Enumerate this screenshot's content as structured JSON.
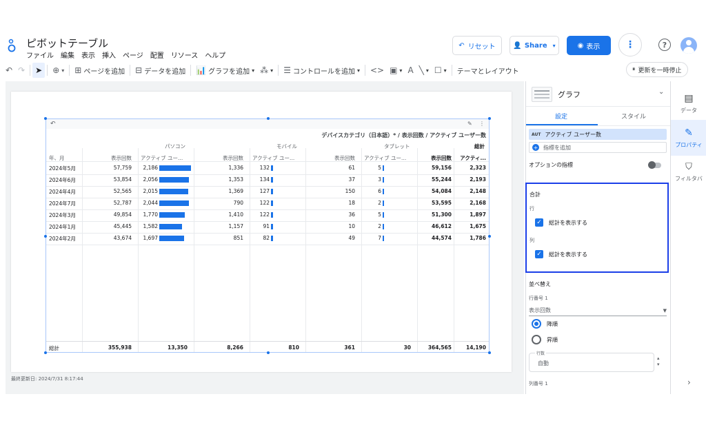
{
  "header": {
    "title": "ピボットテーブル",
    "menu": [
      "ファイル",
      "編集",
      "表示",
      "挿入",
      "ページ",
      "配置",
      "リソース",
      "ヘルプ"
    ],
    "reset_label": "リセット",
    "share_label": "Share",
    "view_label": "表示",
    "help_symbol": "?"
  },
  "toolbar": {
    "add_page": "ページを追加",
    "add_data": "データを追加",
    "add_chart": "グラフを追加",
    "add_control": "コントロールを追加",
    "theme_layout": "テーマとレイアウト",
    "pause_update": "更新を一時停止"
  },
  "canvas": {
    "last_updated": "最終更新日: 2024/7/31 8:17:44"
  },
  "pivot_table": {
    "caption": "デバイスカテゴリ（日本語）* / 表示回数 / アクティブ ユーザー数",
    "group_headers": [
      "パソコン",
      "モバイル",
      "タブレット",
      "総計"
    ],
    "row_dim_header": "年、月",
    "metric_headers": [
      "表示回数",
      "アクティブ ユー...",
      "表示回数",
      "アクティブ ユー...",
      "表示回数",
      "アクティブ ユー...",
      "表示回数",
      "アクティ..."
    ],
    "rows": [
      {
        "month": "2024年5月",
        "pc_views": "57,759",
        "pc_users": "2,186",
        "pc_users_n": 2186,
        "mb_views": "1,336",
        "mb_users": "132",
        "mb_users_n": 132,
        "tb_views": "61",
        "tb_users": "5",
        "tb_users_n": 5,
        "tot_views": "59,156",
        "tot_users": "2,323"
      },
      {
        "month": "2024年6月",
        "pc_views": "53,854",
        "pc_users": "2,056",
        "pc_users_n": 2056,
        "mb_views": "1,353",
        "mb_users": "134",
        "mb_users_n": 134,
        "tb_views": "37",
        "tb_users": "3",
        "tb_users_n": 3,
        "tot_views": "55,244",
        "tot_users": "2,193"
      },
      {
        "month": "2024年4月",
        "pc_views": "52,565",
        "pc_users": "2,015",
        "pc_users_n": 2015,
        "mb_views": "1,369",
        "mb_users": "127",
        "mb_users_n": 127,
        "tb_views": "150",
        "tb_users": "6",
        "tb_users_n": 6,
        "tot_views": "54,084",
        "tot_users": "2,148"
      },
      {
        "month": "2024年7月",
        "pc_views": "52,787",
        "pc_users": "2,044",
        "pc_users_n": 2044,
        "mb_views": "790",
        "mb_users": "122",
        "mb_users_n": 122,
        "tb_views": "18",
        "tb_users": "2",
        "tb_users_n": 2,
        "tot_views": "53,595",
        "tot_users": "2,168"
      },
      {
        "month": "2024年3月",
        "pc_views": "49,854",
        "pc_users": "1,770",
        "pc_users_n": 1770,
        "mb_views": "1,410",
        "mb_users": "122",
        "mb_users_n": 122,
        "tb_views": "36",
        "tb_users": "5",
        "tb_users_n": 5,
        "tot_views": "51,300",
        "tot_users": "1,897"
      },
      {
        "month": "2024年1月",
        "pc_views": "45,445",
        "pc_users": "1,582",
        "pc_users_n": 1582,
        "mb_views": "1,157",
        "mb_users": "91",
        "mb_users_n": 91,
        "tb_views": "10",
        "tb_users": "2",
        "tb_users_n": 2,
        "tot_views": "46,612",
        "tot_users": "1,675"
      },
      {
        "month": "2024年2月",
        "pc_views": "43,674",
        "pc_users": "1,697",
        "pc_users_n": 1697,
        "mb_views": "851",
        "mb_users": "82",
        "mb_users_n": 82,
        "tb_views": "49",
        "tb_users": "7",
        "tb_users_n": 7,
        "tot_views": "44,574",
        "tot_users": "1,786"
      }
    ],
    "totals": {
      "label": "総計",
      "pc_views": "355,938",
      "pc_users": "13,350",
      "mb_views": "8,266",
      "mb_users": "810",
      "tb_views": "361",
      "tb_users": "30",
      "tot_views": "364,565",
      "tot_users": "14,190"
    },
    "bar_color": "#1a73e8"
  },
  "panel": {
    "chart_type": "グラフ",
    "tab_setup": "設定",
    "tab_style": "スタイル",
    "metric_chip_tag": "AUT",
    "metric_chip": "アクティブ ユーザー数",
    "add_metric": "指標を追加",
    "optional_metrics": "オプションの指標",
    "totals_title": "合計",
    "row_label": "行",
    "row_show_total": "総計を表示する",
    "col_label": "列",
    "col_show_total": "総計を表示する",
    "sort_title": "並べ替え",
    "row_no_1": "行番号 1",
    "sort_field": "表示回数",
    "desc": "降順",
    "asc": "昇順",
    "count_label": "行数",
    "count_value": "自動",
    "col_no_1": "列番号 1",
    "highlight_color": "#1a3ee8"
  },
  "rail": {
    "data": "データ",
    "properties": "プロパティ",
    "filter": "フィルタバ"
  }
}
